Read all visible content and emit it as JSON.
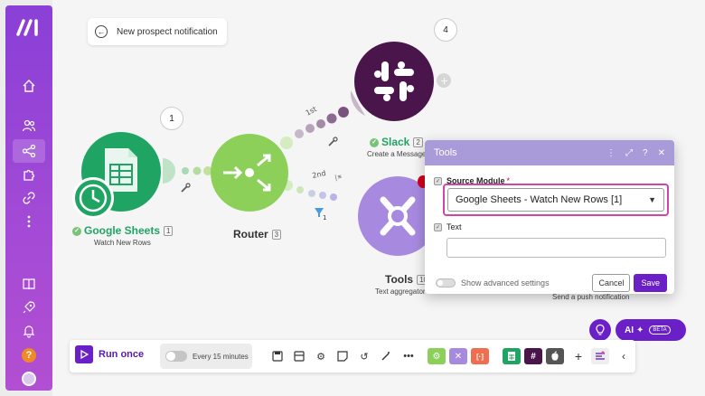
{
  "scenario": {
    "title": "New prospect notification"
  },
  "sidebar": {
    "items": [
      {
        "icon": "home-icon"
      },
      {
        "icon": "users-icon"
      },
      {
        "icon": "share-icon"
      },
      {
        "icon": "puzzle-icon"
      },
      {
        "icon": "link-icon"
      },
      {
        "icon": "more-vertical-icon"
      },
      {
        "icon": "book-icon"
      },
      {
        "icon": "rocket-icon"
      },
      {
        "icon": "bell-icon"
      },
      {
        "icon": "help-icon",
        "label": "?"
      },
      {
        "icon": "avatar-icon"
      }
    ]
  },
  "nodes": {
    "sheets": {
      "name": "Google Sheets",
      "index": "1",
      "sub": "Watch New Rows",
      "badge": "1",
      "color": "#1fa463"
    },
    "router": {
      "name": "Router",
      "index": "3",
      "color": "#8cd05a"
    },
    "slack": {
      "name": "Slack",
      "index": "2",
      "sub": "Create a Message",
      "badge": "4",
      "color": "#4a154b"
    },
    "tools": {
      "name": "Tools",
      "index": "10",
      "sub": "Text aggregator",
      "color": "#a78ae0"
    },
    "push": {
      "sub": "Send a push notification"
    }
  },
  "routes": {
    "first": "1st",
    "second": "2nd",
    "filter_count": "1"
  },
  "dialog": {
    "title": "Tools",
    "source_label": "Source Module",
    "required_mark": "*",
    "source_value": "Google Sheets - Watch New Rows [1]",
    "text_label": "Text",
    "advanced_label": "Show advanced settings",
    "cancel": "Cancel",
    "save": "Save"
  },
  "toolbar": {
    "run_label": "Run once",
    "schedule_label": "Every 15 minutes"
  },
  "ai": {
    "label": "AI",
    "beta": "BETA"
  },
  "colors": {
    "accent": "#6b1fc6",
    "sidebar": "#9b46d6"
  }
}
